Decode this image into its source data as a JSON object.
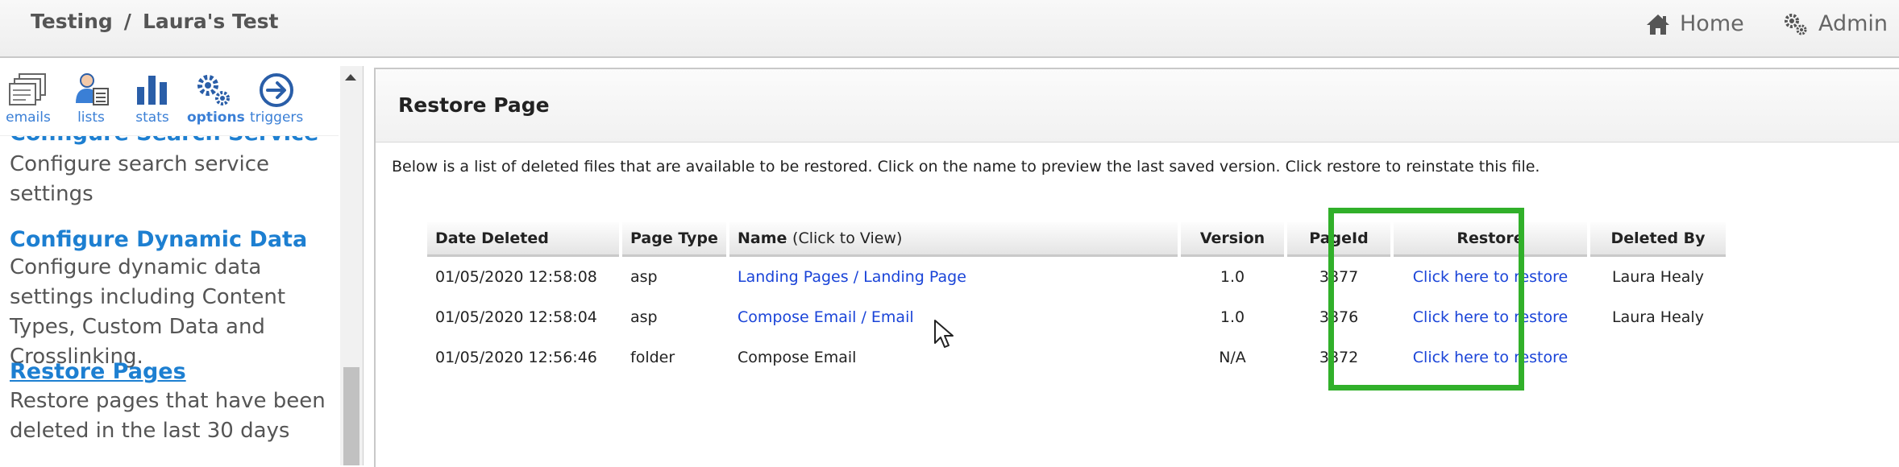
{
  "topbar": {
    "breadcrumb": [
      "Testing",
      "Laura's Test"
    ],
    "separator": "/",
    "home_label": "Home",
    "admin_label": "Admin"
  },
  "sidebar": {
    "toolbar": [
      {
        "label": "emails",
        "icon": "emails-icon"
      },
      {
        "label": "lists",
        "icon": "lists-icon"
      },
      {
        "label": "stats",
        "icon": "stats-icon"
      },
      {
        "label": "options",
        "icon": "gear-icon"
      },
      {
        "label": "triggers",
        "icon": "arrow-circle-icon"
      }
    ],
    "items": [
      {
        "title": "Configure Search Service",
        "desc": "Configure search service settings"
      },
      {
        "title": "Configure Dynamic Data",
        "desc": "Configure dynamic data settings including Content Types, Custom Data and Crosslinking."
      },
      {
        "title": "Restore Pages",
        "desc": "Restore pages that have been deleted in the last 30 days"
      }
    ]
  },
  "main": {
    "title": "Restore Page",
    "intro": "Below is a list of deleted files that are available to be restored. Click on the name to preview the last saved version. Click restore to reinstate this file.",
    "columns": {
      "date": "Date Deleted",
      "type": "Page Type",
      "name": "Name",
      "name_note": "(Click to View)",
      "version": "Version",
      "pageid": "PageId",
      "restore": "Restore",
      "deleted_by": "Deleted By"
    },
    "rows": [
      {
        "date": "01/05/2020 12:58:08",
        "type": "asp",
        "name": "Landing Pages / Landing Page",
        "version": "1.0",
        "pageid": "3877",
        "restore": "Click here to restore",
        "deleted_by": "Laura Healy"
      },
      {
        "date": "01/05/2020 12:58:04",
        "type": "asp",
        "name": "Compose Email / Email",
        "version": "1.0",
        "pageid": "3876",
        "restore": "Click here to restore",
        "deleted_by": "Laura Healy"
      },
      {
        "date": "01/05/2020 12:56:46",
        "type": "folder",
        "name": "Compose Email",
        "version": "N/A",
        "pageid": "3872",
        "restore": "Click here to restore",
        "deleted_by": ""
      }
    ]
  },
  "colors": {
    "link": "#1a44d8",
    "sidebar_link": "#1d7fd1",
    "highlight": "#31b02a"
  }
}
